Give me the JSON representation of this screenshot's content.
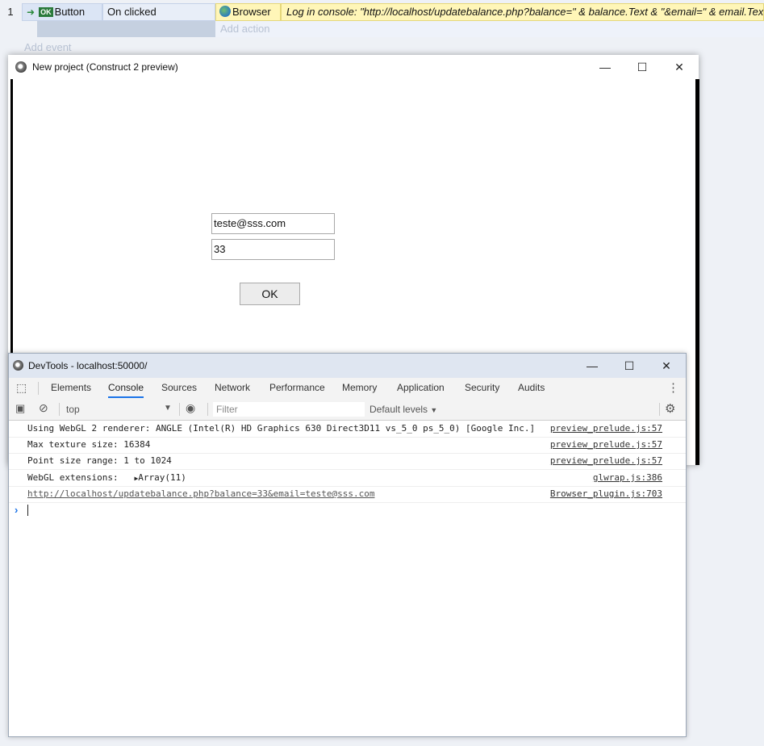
{
  "event_sheet": {
    "row_number": "1",
    "condition_object": "Button",
    "condition_object_badge": "OK",
    "condition_text": "On clicked",
    "action_object": "Browser",
    "action_text": "Log in console: \"http://localhost/updatebalance.php?balance=\" & balance.Text & \"&email=\" & email.Text",
    "add_action": "Add action",
    "add_event": "Add event"
  },
  "preview_window": {
    "title": "New project (Construct 2 preview)",
    "email_value": "teste@sss.com",
    "balance_value": "33",
    "ok_label": "OK"
  },
  "devtools": {
    "title": "DevTools - localhost:50000/",
    "tabs": [
      "Elements",
      "Console",
      "Sources",
      "Network",
      "Performance",
      "Memory",
      "Application",
      "Security",
      "Audits"
    ],
    "active_tab": "Console",
    "context": "top",
    "filter_placeholder": "Filter",
    "levels": "Default levels",
    "console": [
      {
        "msg": "Using WebGL 2 renderer: ANGLE (Intel(R) HD Graphics 630 Direct3D11 vs_5_0 ps_5_0) [Google Inc.]",
        "src": "preview_prelude.js:57"
      },
      {
        "msg": "Max texture size: 16384",
        "src": "preview_prelude.js:57"
      },
      {
        "msg": "Point size range: 1 to 1024",
        "src": "preview_prelude.js:57"
      },
      {
        "msg": "WebGL extensions:",
        "extra": "Array(11)",
        "src": "glwrap.js:386"
      },
      {
        "msg": "http://localhost/updatebalance.php?balance=33&email=teste@sss.com",
        "src": "Browser_plugin.js:703"
      }
    ]
  }
}
